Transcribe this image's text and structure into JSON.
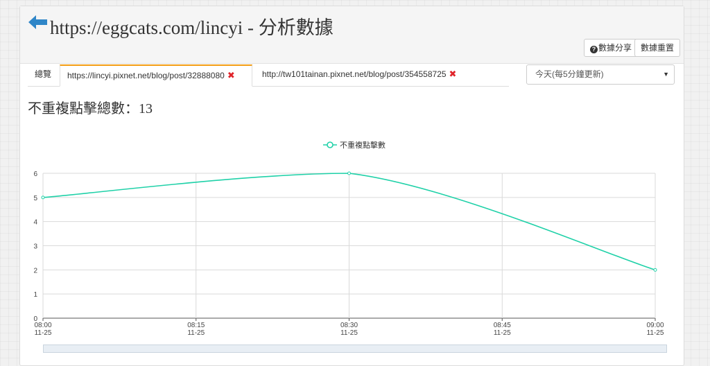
{
  "header": {
    "title": "https://eggcats.com/lincyi - 分析數據",
    "share_label": "數據分享",
    "reset_label": "數據重置"
  },
  "tabs": [
    {
      "label": "總覽",
      "closable": false,
      "active": false
    },
    {
      "label": "https://lincyi.pixnet.net/blog/post/32888080",
      "closable": true,
      "active": true
    },
    {
      "label": "http://tw101tainan.pixnet.net/blog/post/354558725",
      "closable": true,
      "active": false
    }
  ],
  "time_range": {
    "selected": "今天(每5分鐘更新)"
  },
  "stat": {
    "label": "不重複點擊總數：",
    "value": "13"
  },
  "colors": {
    "accent": "#1fd1a8",
    "tab_active_top": "#f39c12",
    "close": "#e0242a"
  },
  "chart_data": {
    "type": "line",
    "series": [
      {
        "name": "不重複點擊數",
        "x": [
          "08:00 11-25",
          "08:30 11-25",
          "09:00 11-25"
        ],
        "values": [
          5,
          6,
          2
        ]
      }
    ],
    "x_ticks": [
      {
        "time": "08:00",
        "date": "11-25"
      },
      {
        "time": "08:15",
        "date": "11-25"
      },
      {
        "time": "08:30",
        "date": "11-25"
      },
      {
        "time": "08:45",
        "date": "11-25"
      },
      {
        "time": "09:00",
        "date": "11-25"
      }
    ],
    "y_ticks": [
      "0",
      "1",
      "2",
      "3",
      "4",
      "5",
      "6"
    ],
    "ylim": [
      0,
      6
    ],
    "xlim": [
      "08:00",
      "09:00"
    ],
    "grid": true,
    "legend_position": "top-center"
  }
}
